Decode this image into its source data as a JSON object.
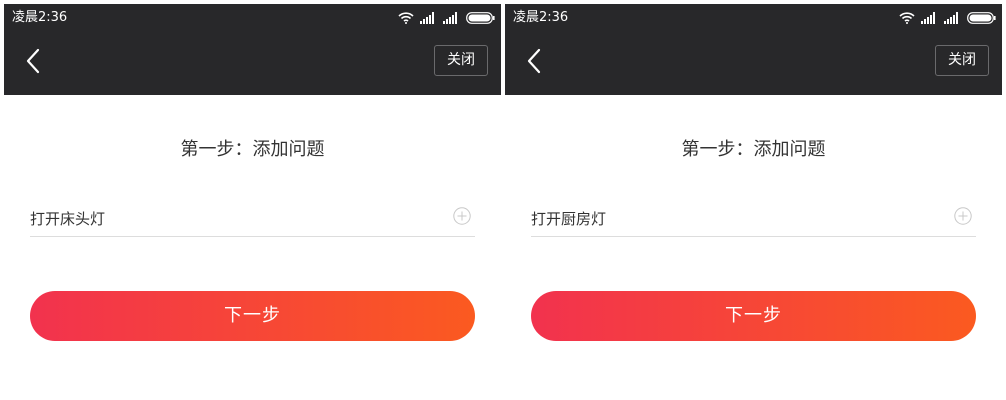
{
  "colors": {
    "topbar_bg": "#28282a",
    "button_gradient_start": "#f2324e",
    "button_gradient_end": "#fb5a20"
  },
  "screens": [
    {
      "status": {
        "time": "凌晨2:36",
        "icons": [
          "wifi-icon",
          "signal-icon",
          "signal-icon",
          "battery-icon"
        ]
      },
      "nav": {
        "back_icon": "chevron-left-icon",
        "close_label": "关闭"
      },
      "step_title": "第一步：添加问题",
      "question": {
        "value": "打开床头灯",
        "add_icon": "plus-circle-icon"
      },
      "next_label": "下一步"
    },
    {
      "status": {
        "time": "凌晨2:36",
        "icons": [
          "wifi-icon",
          "signal-icon",
          "signal-icon",
          "battery-icon"
        ]
      },
      "nav": {
        "back_icon": "chevron-left-icon",
        "close_label": "关闭"
      },
      "step_title": "第一步：添加问题",
      "question": {
        "value": "打开厨房灯",
        "add_icon": "plus-circle-icon"
      },
      "next_label": "下一步"
    }
  ]
}
